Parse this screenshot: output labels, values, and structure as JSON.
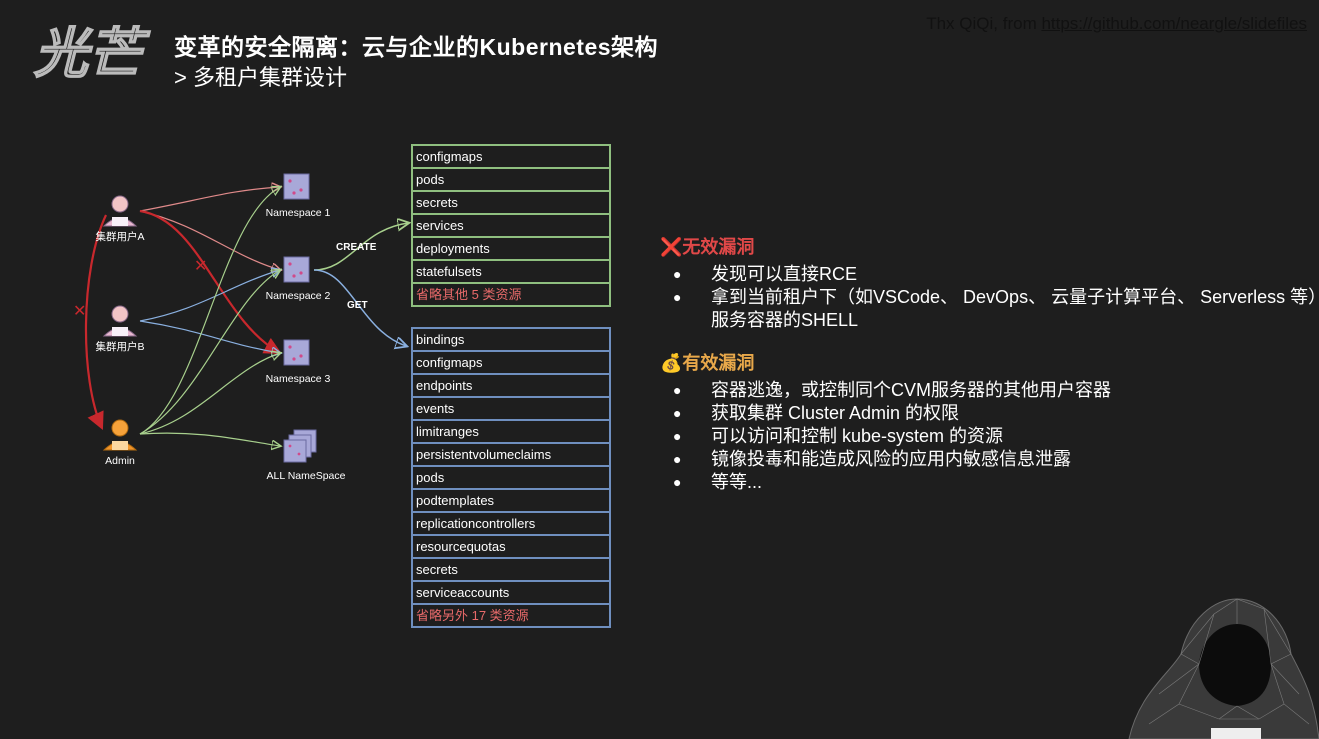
{
  "header": {
    "logo_text": "光芒",
    "title": "变革的安全隔离：云与企业的Kubernetes架构",
    "subtitle": "> 多租户集群设计",
    "credit_prefix": "Thx QiQi, from ",
    "credit_link": "https://github.com/neargle/slidefiles"
  },
  "diagram": {
    "users": [
      "集群用户A",
      "集群用户B",
      "Admin"
    ],
    "namespaces": [
      "Namespace 1",
      "Namespace 2",
      "Namespace 3",
      "ALL NameSpace"
    ],
    "verbs": {
      "create": "CREATE",
      "get": "GET"
    },
    "deny_mark": "✕"
  },
  "create_resources": [
    "configmaps",
    "pods",
    "secrets",
    "services",
    "deployments",
    "statefulsets"
  ],
  "create_omit": "省略其他 5 类资源",
  "get_resources": [
    "bindings",
    "configmaps",
    "endpoints",
    "events",
    "limitranges",
    "persistentvolumeclaims",
    "pods",
    "podtemplates",
    "replicationcontrollers",
    "resourcequotas",
    "secrets",
    "serviceaccounts"
  ],
  "get_omit": "省略另外 17 类资源",
  "invalid": {
    "icon": "❌",
    "title": "无效漏洞",
    "items": [
      "发现可以直接RCE",
      "拿到当前租户下（如VSCode、 DevOps、 云量子计算平台、 Serverless 等）服务容器的SHELL"
    ]
  },
  "valid": {
    "icon": "💰",
    "title": "有效漏洞",
    "items": [
      "容器逃逸，或控制同个CVM服务器的其他用户容器",
      "获取集群 Cluster Admin 的权限",
      "可以访问和控制 kube-system 的资源",
      "镜像投毒和能造成风险的应用内敏感信息泄露",
      "等等..."
    ]
  },
  "colors": {
    "background": "#1e1e1e",
    "deny_red": "#c8282d",
    "create_green": "#8fbf7f",
    "get_blue": "#6f8fbf",
    "omit_red": "#e86a6a",
    "invalid_red": "#e04848",
    "valid_gold": "#e8a84a"
  }
}
